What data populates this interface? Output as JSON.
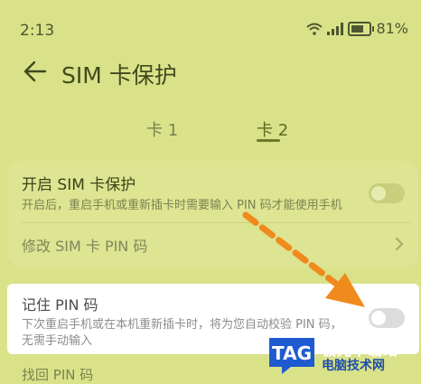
{
  "status_bar": {
    "time": "2:13",
    "battery": "81%",
    "battery_level": 0.81
  },
  "header": {
    "title": "SIM 卡保护"
  },
  "tabs": [
    {
      "label": "卡 1",
      "selected": false
    },
    {
      "label": "卡 2",
      "selected": true
    }
  ],
  "card1": {
    "enable_title": "开启 SIM 卡保护",
    "enable_desc": "开启后，重启手机或重新插卡时需要输入 PIN 码才能使用手机",
    "enable_on": false,
    "modify_title": "修改 SIM 卡 PIN 码"
  },
  "card2": {
    "remember_title": "记住 PIN 码",
    "remember_desc_1": "下次重启手机或在本机重新插卡时，将为您自动校验 PIN 码，",
    "remember_desc_2": "无需手动输入",
    "remember_on": false
  },
  "partial_row": {
    "title": "找回 PIN 码"
  },
  "watermark": {
    "logo": "TAG",
    "line1": "极光下载站",
    "line2": "电脑技术网"
  },
  "colors": {
    "background": "#d9e289",
    "arrow": "#f08a1c",
    "highlight_card": "#ffffff"
  }
}
